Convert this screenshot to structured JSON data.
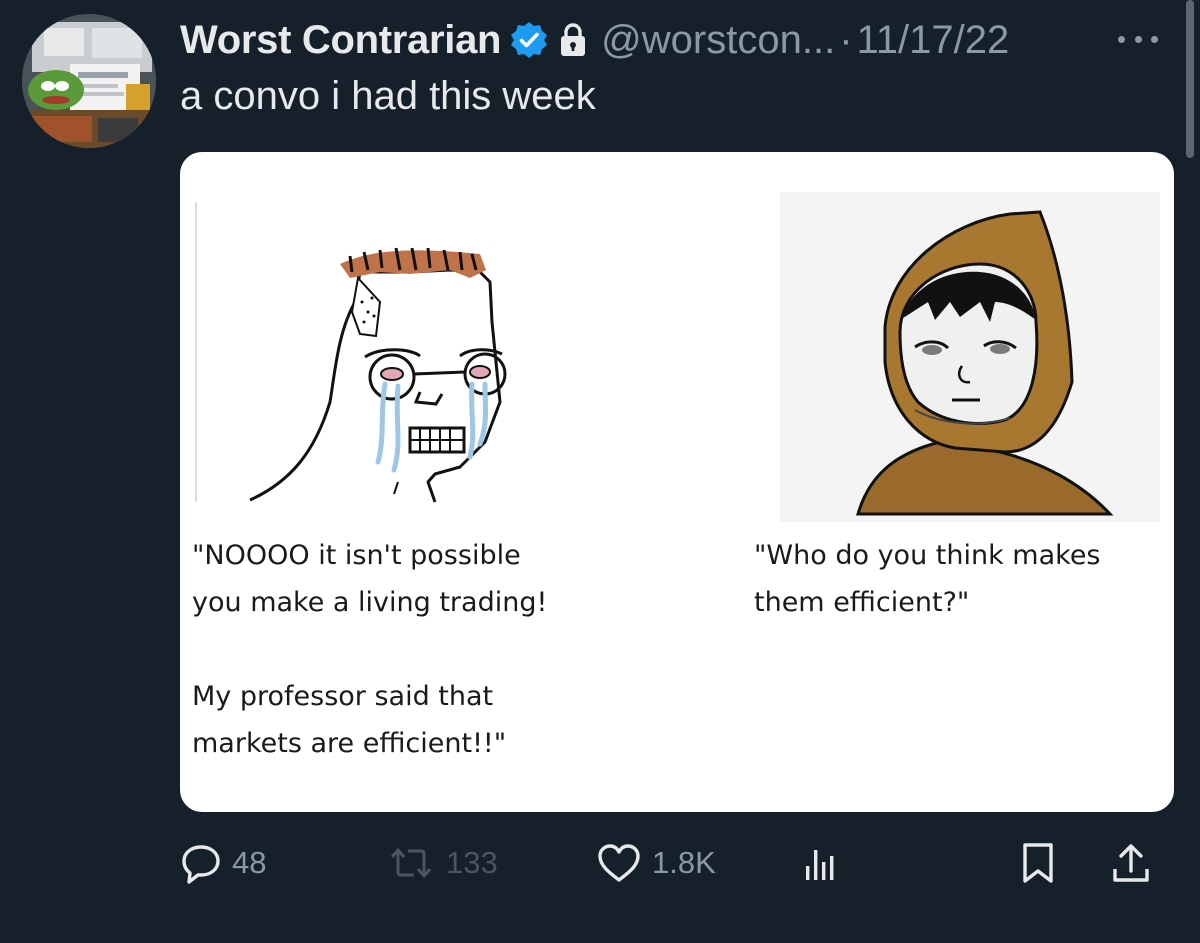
{
  "author": {
    "display_name": "Worst Contrarian",
    "verified_icon": "verified-badge-icon",
    "lock_icon": "lock-icon",
    "handle": "@worstcon...",
    "separator": "·",
    "date": "11/17/22"
  },
  "tweet": {
    "text": "a convo i had this week"
  },
  "meme": {
    "left_caption": "\"NOOOO it isn't possible\nyou make a living trading!\n\nMy professor said that\nmarkets are efficient!!\"",
    "right_caption": "\"Who do you think makes\nthem efficient?\""
  },
  "actions": {
    "reply": {
      "icon": "reply-icon",
      "count": "48"
    },
    "retweet": {
      "icon": "retweet-icon",
      "count": "133"
    },
    "like": {
      "icon": "heart-icon",
      "count": "1.8K"
    },
    "views": {
      "icon": "views-icon"
    },
    "bookmark": {
      "icon": "bookmark-icon"
    },
    "share": {
      "icon": "share-icon"
    }
  },
  "colors": {
    "background": "#15202b",
    "text_primary": "#e7e9ea",
    "text_secondary": "#8b98a5",
    "verified_blue": "#1d9bf0"
  }
}
